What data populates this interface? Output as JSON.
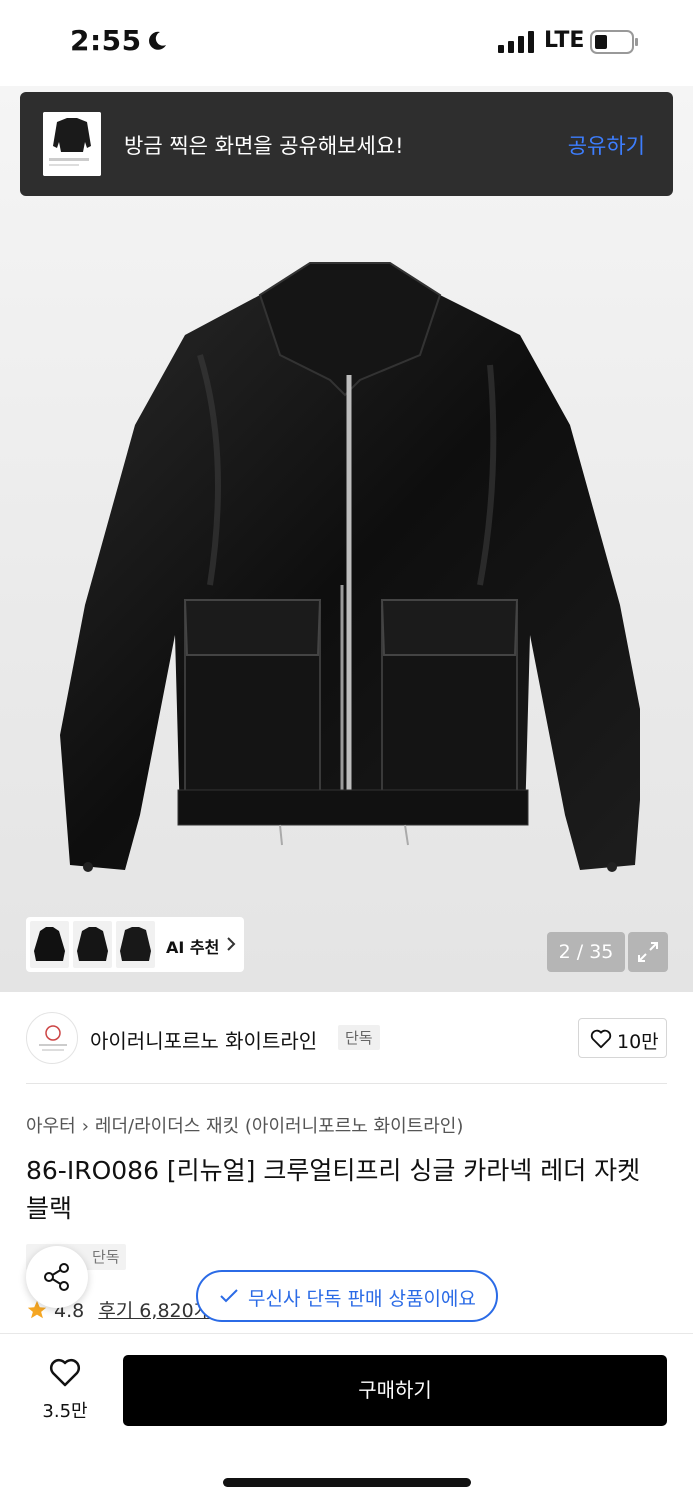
{
  "status_bar": {
    "time": "2:55",
    "network": "LTE"
  },
  "share_banner": {
    "text": "방금 찍은 화면을 공유해보세요!",
    "action": "공유하기"
  },
  "gallery": {
    "ai_label": "AI 추천",
    "counter": "2 / 35"
  },
  "brand": {
    "name": "아이러니포르노 화이트라인",
    "badge": "단독",
    "likes": "10만"
  },
  "breadcrumb": {
    "category": "아우터",
    "subcategory": "레더/라이더스 재킷 (아이러니포르노 화이트라인)"
  },
  "product": {
    "title": "86-IRO086 [리뉴얼] 크루얼티프리 싱글 카라넥 레더 자켓 블랙",
    "tag": "단독"
  },
  "rating": {
    "score": "4.8",
    "reviews": "후기 6,820개"
  },
  "exclusive_notice": "무신사 단독 판매 상품이에요",
  "bottom_bar": {
    "wish_count": "3.5만",
    "buy_label": "구매하기"
  },
  "colors": {
    "accent_blue": "#2b6be6",
    "share_link_blue": "#3d7eff",
    "star": "#f5a623",
    "buy_button": "#000000"
  },
  "icons": [
    "moon-icon",
    "signal-icon",
    "battery-icon",
    "chevron-right-icon",
    "expand-icon",
    "heart-icon",
    "share-icon",
    "star-icon",
    "check-icon"
  ]
}
